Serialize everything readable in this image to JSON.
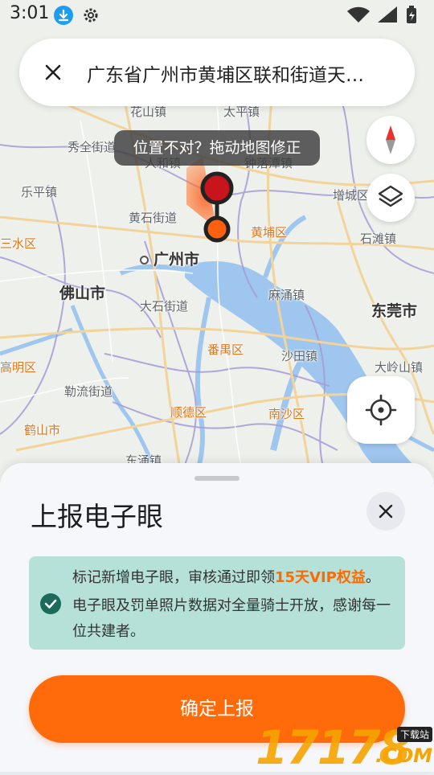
{
  "status_bar": {
    "time": "3:01"
  },
  "search": {
    "address": "广东省广州市黄埔区联和街道天…"
  },
  "map": {
    "tooltip": "位置不对？拖动地图修正",
    "labels": {
      "huashan": "花山镇",
      "taihe": "太平镇",
      "xiuquan": "秀全街道",
      "renhe": "人和镇",
      "zhongluotan": "钟落潭镇",
      "zengcheng": "增城区",
      "lepeng": "乐平镇",
      "huangshi": "黄石街道",
      "huangpu": "黄埔区",
      "shitan": "石滩镇",
      "sanshui": "三水区",
      "guangzhou": "广州市",
      "foshan": "佛山市",
      "mayong": "麻涌镇",
      "dongguan": "东莞市",
      "dashi": "大石街道",
      "panyu": "番禺区",
      "shawan": "沙田镇",
      "gaoming": "高明区",
      "dalingshan": "大岭山镇",
      "bojiao": "勒流街道",
      "shunde": "顺德区",
      "nansha": "南沙区",
      "heshan": "鹤山市",
      "dongyong": "东涌镇"
    }
  },
  "sheet": {
    "title": "上报电子眼",
    "notice_prefix": "标记新增电子眼，审核通过即领",
    "notice_highlight": "15天VIP权益",
    "notice_suffix": "。",
    "notice_body": "电子眼及罚单照片数据对全量骑士开放，感谢每一位共建者。",
    "submit_label": "确定上报"
  },
  "watermark": {
    "digits": "17178",
    "tag": "下载站",
    "suffix": ".COM"
  },
  "colors": {
    "accent": "#ff6a0a",
    "notice_bg": "#b5e1d8",
    "highlight": "#ff6a00",
    "check": "#1a6b5a"
  },
  "icons": [
    "download-icon",
    "gear-icon",
    "wifi-icon",
    "signal-icon",
    "battery-icon",
    "close-icon",
    "compass-icon",
    "layers-icon",
    "locate-icon",
    "check-icon",
    "location-pin-icon"
  ]
}
